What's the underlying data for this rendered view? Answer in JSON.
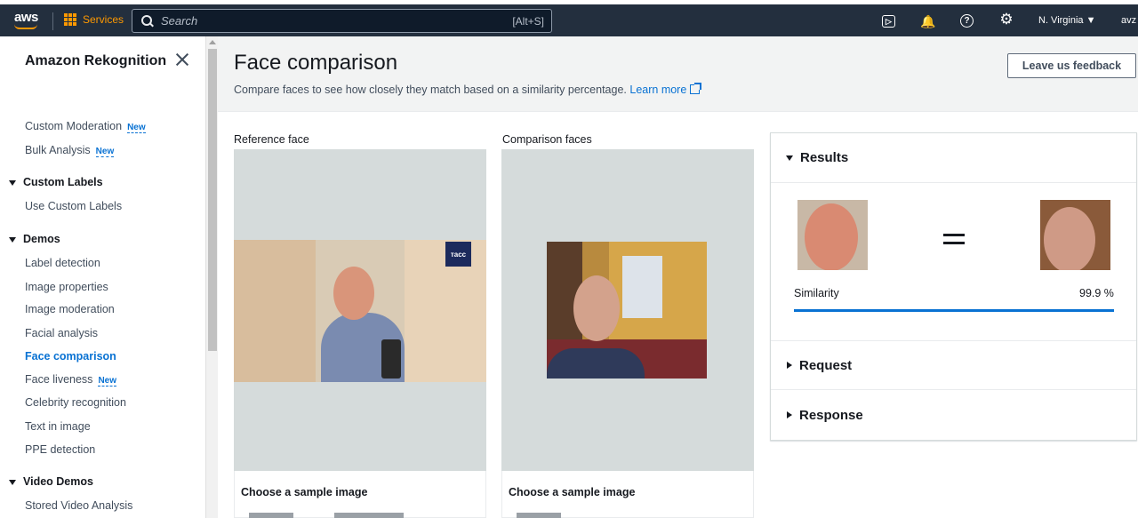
{
  "topbar": {
    "logo_text": "aws",
    "services_label": "Services",
    "search_placeholder": "Search",
    "search_shortcut": "[Alt+S]",
    "cloudshell_glyph": "▷",
    "bell_glyph": "🔔",
    "help_glyph": "?",
    "gear_glyph": "⚙",
    "region": "N. Virginia ▼",
    "account": "avz"
  },
  "sidebar": {
    "title": "Amazon Rekognition",
    "new_badge": "New",
    "items": [
      {
        "label": "Custom Moderation",
        "new": true
      },
      {
        "label": "Bulk Analysis",
        "new": true
      }
    ],
    "custom_labels": {
      "section": "Custom Labels",
      "items": [
        "Use Custom Labels"
      ]
    },
    "demos": {
      "section": "Demos",
      "items": [
        "Label detection",
        "Image properties",
        "Image moderation",
        "Facial analysis",
        "Face comparison",
        "Face liveness",
        "Celebrity recognition",
        "Text in image",
        "PPE detection"
      ],
      "active": "Face comparison"
    },
    "video_demos": {
      "section": "Video Demos",
      "items": [
        "Stored Video Analysis"
      ]
    }
  },
  "header": {
    "title": "Face comparison",
    "description": "Compare faces to see how closely they match based on a similarity percentage.",
    "learn_more": "Learn more",
    "feedback_button": "Leave us feedback"
  },
  "reference": {
    "label": "Reference face",
    "watermark": "тасс",
    "sample_title": "Choose a sample image"
  },
  "comparison": {
    "label": "Comparison faces",
    "sample_title": "Choose a sample image"
  },
  "results": {
    "title": "Results",
    "similarity_label": "Similarity",
    "similarity_value": "99.9 %",
    "similarity_fraction": 0.999,
    "request_label": "Request",
    "response_label": "Response",
    "accent_color": "#0972d3"
  }
}
